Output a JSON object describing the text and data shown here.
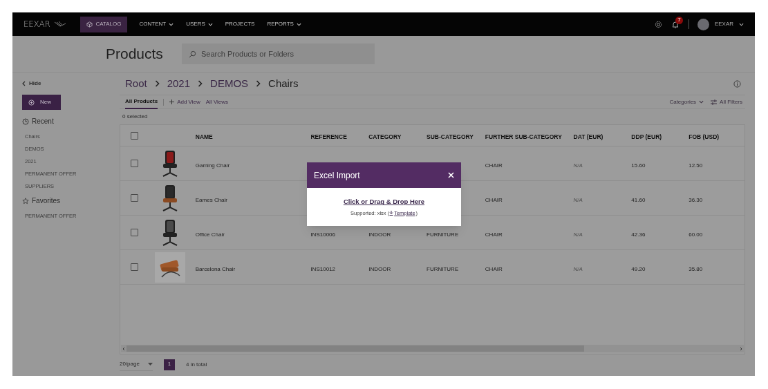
{
  "nav": {
    "logo": "EEXAR",
    "items": [
      {
        "label": "CATALOG",
        "selected": true,
        "dropdown": false
      },
      {
        "label": "CONTENT",
        "selected": false,
        "dropdown": true
      },
      {
        "label": "USERS",
        "selected": false,
        "dropdown": true
      },
      {
        "label": "PROJECTS",
        "selected": false,
        "dropdown": false
      },
      {
        "label": "REPORTS",
        "selected": false,
        "dropdown": true
      }
    ],
    "notifications": "7",
    "user": "EEXAR"
  },
  "page": {
    "title": "Products",
    "search": {
      "placeholder": "Search Products or Folders"
    }
  },
  "sidebar": {
    "hide": "Hide",
    "new_button": "New",
    "recent": {
      "title": "Recent",
      "items": [
        "Chairs",
        "DEMOS",
        "2021",
        "PERMANENT OFFER",
        "SUPPLIERS"
      ]
    },
    "favorites": {
      "title": "Favorites",
      "items": [
        "PERMANENT OFFER"
      ]
    }
  },
  "breadcrumb": [
    "Root",
    "2021",
    "DEMOS",
    "Chairs"
  ],
  "views": [
    {
      "label": "All Products",
      "kind": "view",
      "selected": true
    },
    {
      "label": "Add View",
      "kind": "add",
      "selected": false
    },
    {
      "label": "All Views",
      "kind": "view",
      "selected": false
    }
  ],
  "filters": {
    "categories": "Categories",
    "all_filters": "All Filters"
  },
  "selection": "0 selected",
  "table": {
    "columns": [
      "NAME",
      "REFERENCE",
      "CATEGORY",
      "SUB-CATEGORY",
      "FURTHER SUB-CATEGORY",
      "DAT (EUR)",
      "DDP (EUR)",
      "FOB (USD)"
    ],
    "header_checked": false,
    "rows": [
      {
        "checked": false,
        "name": "Gaming Chair",
        "further_sub_category": "CHAIR",
        "dat": "N/A",
        "ddp": "15.60",
        "fob": "12.50"
      },
      {
        "checked": false,
        "name": "Eames Chair",
        "further_sub_category": "CHAIR",
        "dat": "N/A",
        "ddp": "41.60",
        "fob": "36.30"
      },
      {
        "checked": false,
        "name": "Office Chair",
        "reference": "INS10006",
        "category": "INDOOR",
        "sub_category": "FURNITURE",
        "further_sub_category": "CHAIR",
        "dat": "N/A",
        "ddp": "42.36",
        "fob": "60.00"
      },
      {
        "checked": false,
        "name": "Barcelona Chair",
        "reference": "INS10012",
        "category": "INDOOR",
        "sub_category": "FURNITURE",
        "further_sub_category": "CHAIR",
        "dat": "N/A",
        "ddp": "49.20",
        "fob": "35.80"
      }
    ]
  },
  "pagination": {
    "page_size": "20/page",
    "pages": [
      {
        "label": "1",
        "selected": true
      }
    ],
    "total": "4 in total"
  },
  "modal": {
    "title": "Excel Import",
    "drop_link": "Click or Drag & Drop Here",
    "supported_prefix": "Supported: xlsx (",
    "template_link": "Template",
    "supported_suffix": ")"
  }
}
